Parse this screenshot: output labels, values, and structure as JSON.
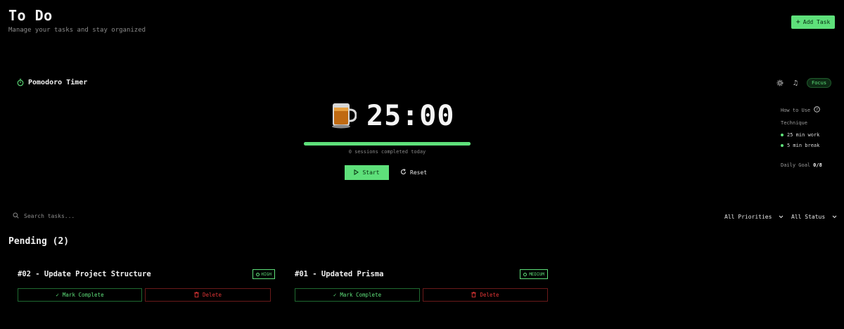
{
  "header": {
    "title": "To Do",
    "subtitle": "Manage your tasks and stay organized",
    "add_task_label": "Add Task"
  },
  "pomodoro": {
    "title": "Pomodoro Timer",
    "mode_badge": "Focus",
    "time": "25:00",
    "progress_fraction": 1.0,
    "sessions_text": "0 sessions completed today",
    "start_label": "Start",
    "reset_label": "Reset",
    "side": {
      "how_to_use": "How to Use",
      "technique_label": "Technique",
      "work": "25 min work",
      "break": "5 min break",
      "daily_goal_label": "Daily Goal",
      "daily_goal_value": "0/8"
    },
    "icons": [
      "stopwatch-icon",
      "settings-icon",
      "music-icon",
      "tea-cup-icon",
      "help-circle-icon"
    ]
  },
  "toolbar": {
    "search_placeholder": "Search tasks...",
    "priority_filter": "All Priorities",
    "status_filter": "All Status"
  },
  "pending": {
    "heading": "Pending (2)",
    "tasks": [
      {
        "title": "#02 - Update Project Structure",
        "priority": "HIGH",
        "complete_label": "Mark Complete",
        "delete_label": "Delete"
      },
      {
        "title": "#01 - Updated Prisma",
        "priority": "MEDIUM",
        "complete_label": "Mark Complete",
        "delete_label": "Delete"
      }
    ]
  },
  "colors": {
    "accent": "#5ee07a",
    "danger": "#e03535",
    "background": "#000000"
  }
}
